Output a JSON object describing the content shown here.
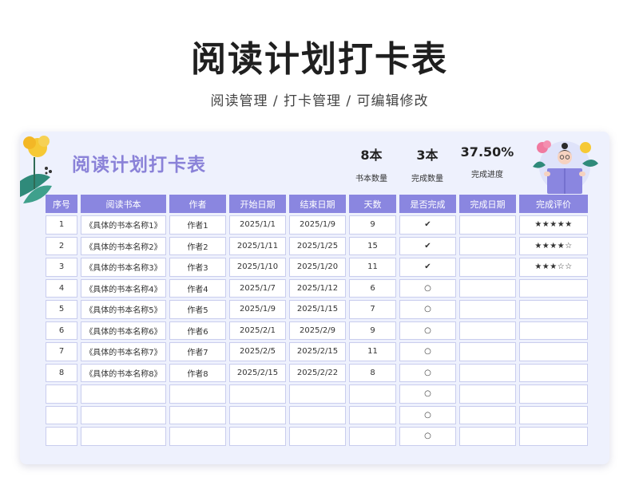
{
  "page": {
    "title": "阅读计划打卡表",
    "subtitle": "阅读管理 /  打卡管理  /  可编辑修改"
  },
  "card": {
    "title": "阅读计划打卡表",
    "stats": [
      {
        "value": "8本",
        "label": "书本数量"
      },
      {
        "value": "3本",
        "label": "完成数量"
      },
      {
        "value": "37.50%",
        "label": "完成进度"
      }
    ]
  },
  "colors": {
    "accent": "#8a86e0",
    "title_purple": "#8a82d8",
    "card_bg": "#eef1fd",
    "cell_border": "#c9cdee"
  },
  "icons": {
    "done": "check-icon",
    "not_done": "circle-icon",
    "rating": "star-icon"
  },
  "table": {
    "headers": [
      "序号",
      "阅读书本",
      "作者",
      "开始日期",
      "结束日期",
      "天数",
      "是否完成",
      "完成日期",
      "完成评价"
    ],
    "rows": [
      {
        "no": "1",
        "book": "《具体的书本名称1》",
        "author": "作者1",
        "start": "2025/1/1",
        "end": "2025/1/9",
        "days": "9",
        "done": "✔",
        "done_date": "",
        "rating": "★★★★★"
      },
      {
        "no": "2",
        "book": "《具体的书本名称2》",
        "author": "作者2",
        "start": "2025/1/11",
        "end": "2025/1/25",
        "days": "15",
        "done": "✔",
        "done_date": "",
        "rating": "★★★★☆"
      },
      {
        "no": "3",
        "book": "《具体的书本名称3》",
        "author": "作者3",
        "start": "2025/1/10",
        "end": "2025/1/20",
        "days": "11",
        "done": "✔",
        "done_date": "",
        "rating": "★★★☆☆"
      },
      {
        "no": "4",
        "book": "《具体的书本名称4》",
        "author": "作者4",
        "start": "2025/1/7",
        "end": "2025/1/12",
        "days": "6",
        "done": "○",
        "done_date": "",
        "rating": ""
      },
      {
        "no": "5",
        "book": "《具体的书本名称5》",
        "author": "作者5",
        "start": "2025/1/9",
        "end": "2025/1/15",
        "days": "7",
        "done": "○",
        "done_date": "",
        "rating": ""
      },
      {
        "no": "6",
        "book": "《具体的书本名称6》",
        "author": "作者6",
        "start": "2025/2/1",
        "end": "2025/2/9",
        "days": "9",
        "done": "○",
        "done_date": "",
        "rating": ""
      },
      {
        "no": "7",
        "book": "《具体的书本名称7》",
        "author": "作者7",
        "start": "2025/2/5",
        "end": "2025/2/15",
        "days": "11",
        "done": "○",
        "done_date": "",
        "rating": ""
      },
      {
        "no": "8",
        "book": "《具体的书本名称8》",
        "author": "作者8",
        "start": "2025/2/15",
        "end": "2025/2/22",
        "days": "8",
        "done": "○",
        "done_date": "",
        "rating": ""
      },
      {
        "no": "",
        "book": "",
        "author": "",
        "start": "",
        "end": "",
        "days": "",
        "done": "○",
        "done_date": "",
        "rating": ""
      },
      {
        "no": "",
        "book": "",
        "author": "",
        "start": "",
        "end": "",
        "days": "",
        "done": "○",
        "done_date": "",
        "rating": ""
      },
      {
        "no": "",
        "book": "",
        "author": "",
        "start": "",
        "end": "",
        "days": "",
        "done": "○",
        "done_date": "",
        "rating": ""
      }
    ]
  }
}
